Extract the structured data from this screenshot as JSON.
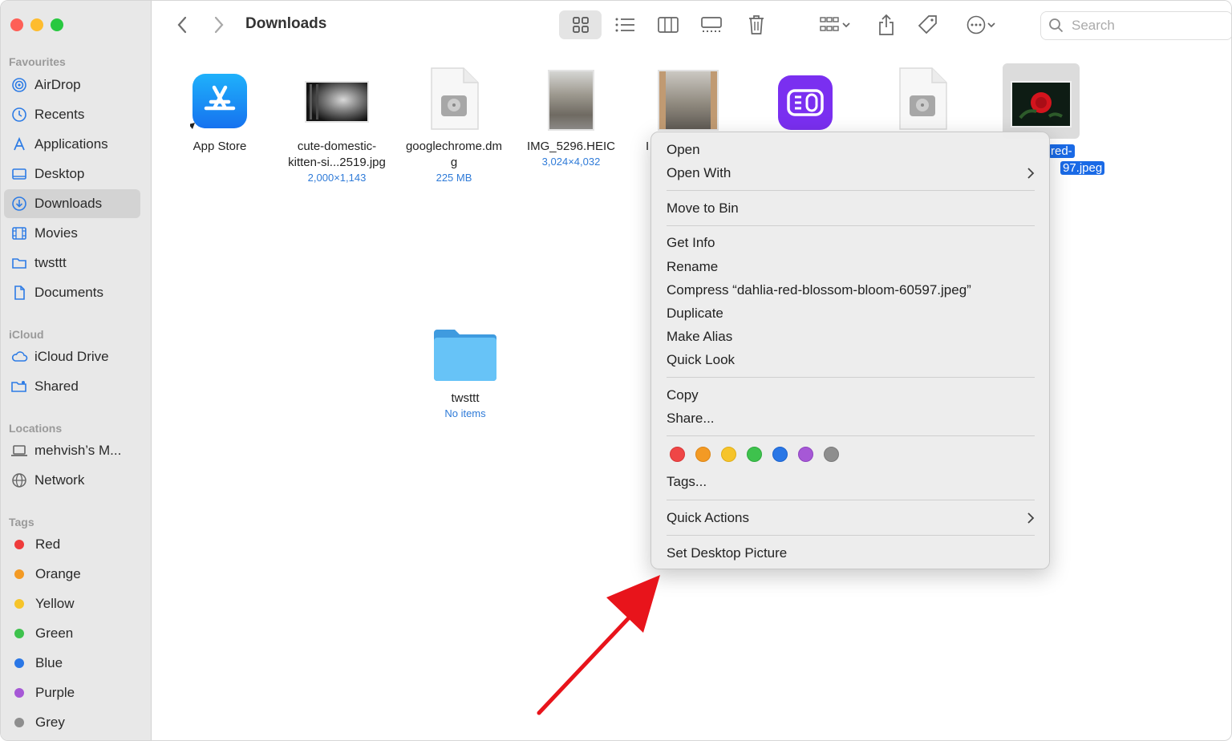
{
  "window": {
    "title": "Downloads",
    "search_placeholder": "Search"
  },
  "sidebar": {
    "sections": [
      {
        "label": "Favourites",
        "items": [
          "AirDrop",
          "Recents",
          "Applications",
          "Desktop",
          "Downloads",
          "Movies",
          "twsttt",
          "Documents"
        ]
      },
      {
        "label": "iCloud",
        "items": [
          "iCloud Drive",
          "Shared"
        ]
      },
      {
        "label": "Locations",
        "items": [
          "mehvish’s M...",
          "Network"
        ]
      },
      {
        "label": "Tags",
        "items": [
          "Red",
          "Orange",
          "Yellow",
          "Green",
          "Blue",
          "Purple",
          "Grey"
        ]
      }
    ],
    "active_item": "Downloads",
    "tag_colors": [
      "#ef3b3b",
      "#f39a24",
      "#f6c42a",
      "#3ec24d",
      "#2a77e6",
      "#a658d6",
      "#8e8e8e"
    ]
  },
  "files": [
    {
      "name": "App Store",
      "meta": ""
    },
    {
      "name_line1": "cute-domestic-",
      "name_line2": "kitten-si...2519.jpg",
      "meta": "2,000×1,143"
    },
    {
      "name_line1": "googlechrome.dm",
      "name_line2": "g",
      "meta": "225 MB"
    },
    {
      "name": "IMG_5296.HEIC",
      "meta": "3,024×4,032"
    },
    {
      "name_partial": "I"
    },
    {
      "selected_line1": "red-",
      "selected_line2": "97.jpeg"
    },
    {
      "name": "twsttt",
      "meta": "No items"
    }
  ],
  "context_menu": {
    "items": {
      "open": "Open",
      "open_with": "Open With",
      "move_to_bin": "Move to Bin",
      "get_info": "Get Info",
      "rename": "Rename",
      "compress": "Compress “dahlia-red-blossom-bloom-60597.jpeg”",
      "duplicate": "Duplicate",
      "make_alias": "Make Alias",
      "quick_look": "Quick Look",
      "copy": "Copy",
      "share": "Share...",
      "tags": "Tags...",
      "quick_actions": "Quick Actions",
      "set_desktop_picture": "Set Desktop Picture"
    },
    "tag_swatches": [
      "#ef4646",
      "#f39a24",
      "#f6c42a",
      "#3ec24d",
      "#2a77e6",
      "#a658d6",
      "#8e8e8e"
    ]
  },
  "annotation": {
    "arrow_color": "#e8141b"
  }
}
